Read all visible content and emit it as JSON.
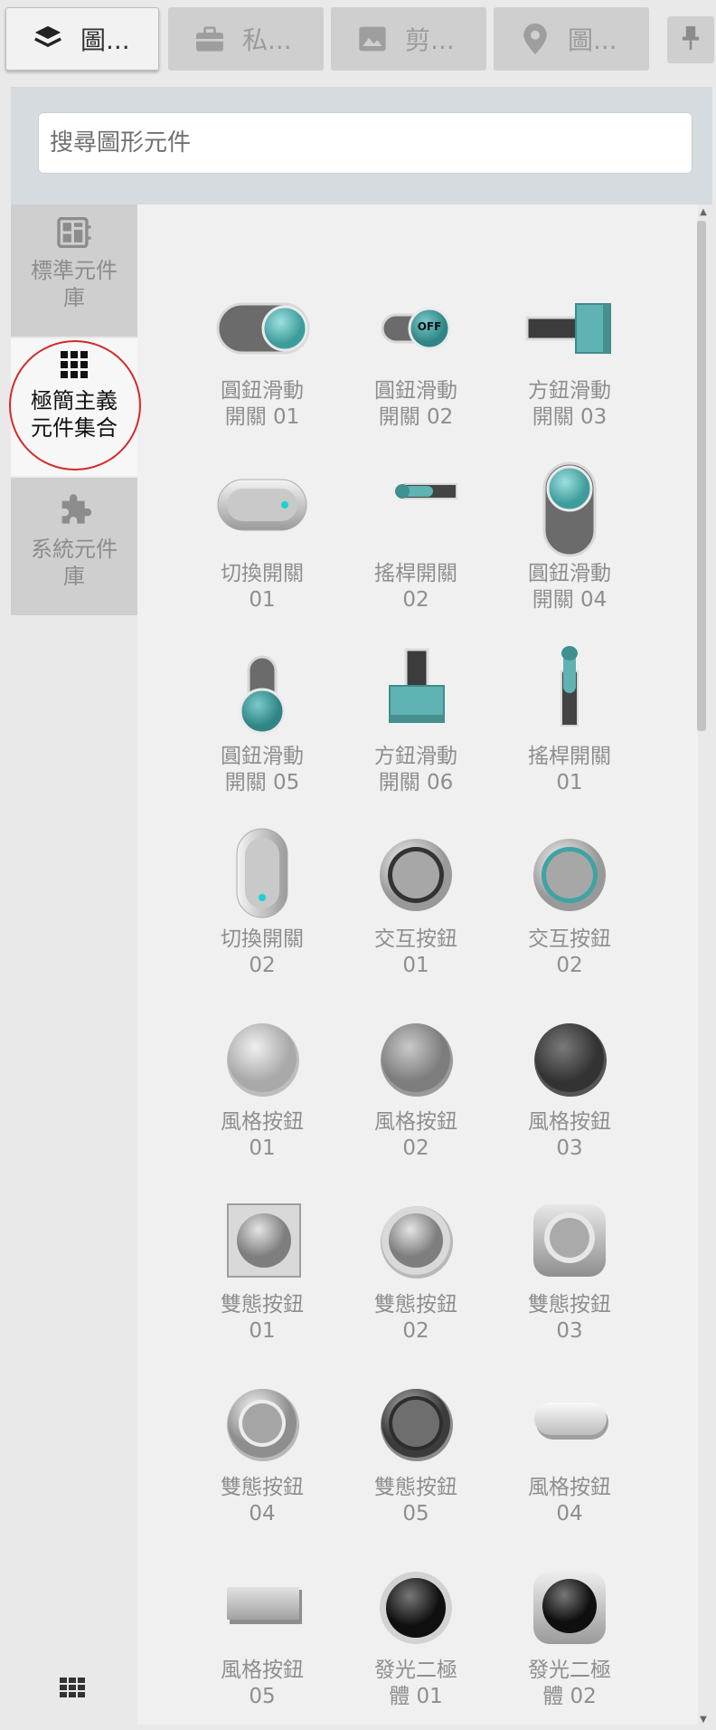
{
  "tabs": [
    {
      "label": "圖...",
      "icon": "layers-icon",
      "active": true
    },
    {
      "label": "私...",
      "icon": "briefcase-icon",
      "active": false
    },
    {
      "label": "剪...",
      "icon": "image-icon",
      "active": false
    },
    {
      "label": "圖...",
      "icon": "map-pin-icon",
      "active": false
    }
  ],
  "pin_icon": "pin-icon",
  "search": {
    "placeholder": "搜尋圖形元件"
  },
  "side_nav": [
    {
      "label_line1": "標準元件",
      "label_line2": "庫",
      "icon": "layout-grid-icon",
      "active": false
    },
    {
      "label_line1": "極簡主義",
      "label_line2": "元件集合",
      "icon": "dots-grid-icon",
      "active": true
    },
    {
      "label_line1": "系統元件",
      "label_line2": "庫",
      "icon": "puzzle-icon",
      "active": false
    }
  ],
  "widgets": [
    {
      "line1": "圓鈕滑動",
      "line2": "開關 01"
    },
    {
      "line1": "圓鈕滑動",
      "line2": "開關 02",
      "badge": "OFF"
    },
    {
      "line1": "方鈕滑動",
      "line2": "開關 03"
    },
    {
      "line1": "切換開關",
      "line2": "01"
    },
    {
      "line1": "搖桿開關",
      "line2": "02"
    },
    {
      "line1": "圓鈕滑動",
      "line2": "開關 04"
    },
    {
      "line1": "圓鈕滑動",
      "line2": "開關 05"
    },
    {
      "line1": "方鈕滑動",
      "line2": "開關 06"
    },
    {
      "line1": "搖桿開關",
      "line2": "01"
    },
    {
      "line1": "切換開關",
      "line2": "02"
    },
    {
      "line1": "交互按鈕",
      "line2": "01"
    },
    {
      "line1": "交互按鈕",
      "line2": "02"
    },
    {
      "line1": "風格按鈕",
      "line2": "01"
    },
    {
      "line1": "風格按鈕",
      "line2": "02"
    },
    {
      "line1": "風格按鈕",
      "line2": "03"
    },
    {
      "line1": "雙態按鈕",
      "line2": "01"
    },
    {
      "line1": "雙態按鈕",
      "line2": "02"
    },
    {
      "line1": "雙態按鈕",
      "line2": "03"
    },
    {
      "line1": "雙態按鈕",
      "line2": "04"
    },
    {
      "line1": "雙態按鈕",
      "line2": "05"
    },
    {
      "line1": "風格按鈕",
      "line2": "04"
    },
    {
      "line1": "風格按鈕",
      "line2": "05"
    },
    {
      "line1": "發光二極",
      "line2": "體 01"
    },
    {
      "line1": "發光二極",
      "line2": "體 02"
    }
  ],
  "colors": {
    "accent": "#5fb3b3",
    "teal_dark": "#3f8f8f",
    "annotation": "#d42a2a"
  }
}
